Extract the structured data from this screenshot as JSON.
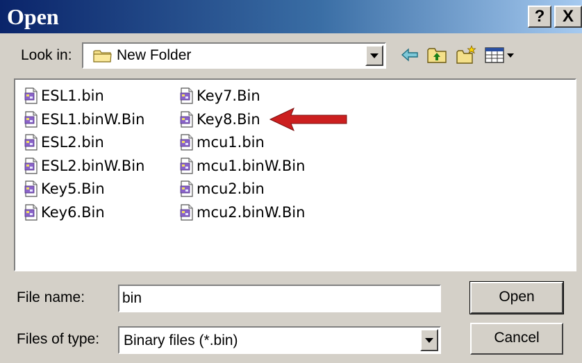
{
  "window": {
    "title": "Open",
    "help_label": "?",
    "close_label": "X"
  },
  "lookin": {
    "label": "Look in:",
    "value": "New Folder"
  },
  "toolbar": {
    "icons": [
      "back-icon",
      "up-folder-icon",
      "new-folder-icon",
      "view-menu-icon"
    ]
  },
  "files": [
    "ESL1.bin",
    "ESL1.binW.Bin",
    "ESL2.bin",
    "ESL2.binW.Bin",
    "Key5.Bin",
    "Key6.Bin",
    "Key7.Bin",
    "Key8.Bin",
    "mcu1.bin",
    "mcu1.binW.Bin",
    "mcu2.bin",
    "mcu2.binW.Bin"
  ],
  "annotation": {
    "arrow_color": "#cc1f1f",
    "points_to": "Key8.Bin"
  },
  "filename": {
    "label": "File name:",
    "value": "bin"
  },
  "filetype": {
    "label": "Files of type:",
    "value": "Binary files (*.bin)"
  },
  "buttons": {
    "open": "Open",
    "cancel": "Cancel"
  }
}
